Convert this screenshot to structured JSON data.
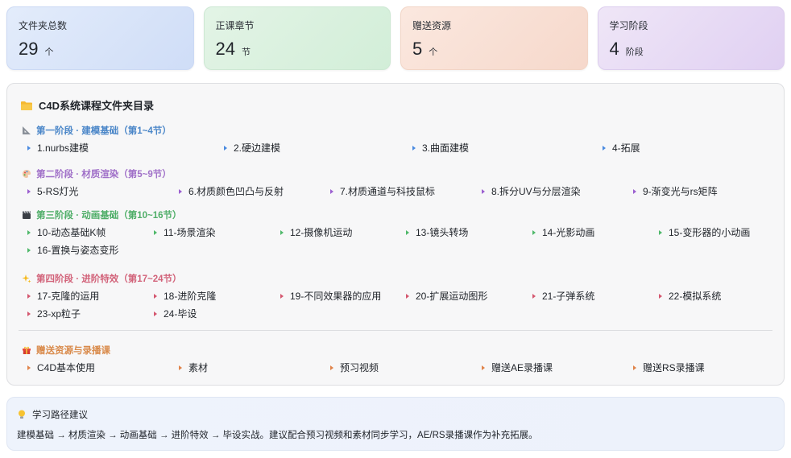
{
  "stats": [
    {
      "label": "文件夹总数",
      "value": "29",
      "unit": "个"
    },
    {
      "label": "正课章节",
      "value": "24",
      "unit": "节"
    },
    {
      "label": "赠送资源",
      "value": "5",
      "unit": "个"
    },
    {
      "label": "学习阶段",
      "value": "4",
      "unit": "阶段"
    }
  ],
  "catalog": {
    "title": "C4D系统课程文件夹目录",
    "icon": "folder-icon",
    "stages": [
      {
        "title": "第一阶段 · 建模基础（第1~4节）",
        "icon": "ruler-triangle-icon",
        "color": "#4a86c8",
        "marker_color": "#4a8ae0",
        "items": [
          "1.nurbs建模",
          "2.硬边建模",
          "3.曲面建模",
          "4-拓展"
        ]
      },
      {
        "title": "第二阶段 · 材质渲染（第5~9节）",
        "icon": "palette-icon",
        "color": "#a070c8",
        "marker_color": "#9b5fd0",
        "items": [
          "5-RS灯光",
          "6.材质颜色凹凸与反射",
          "7.材质通道与科技鼠标",
          "8.拆分UV与分层渲染",
          "9-渐变光与rs矩阵"
        ]
      },
      {
        "title": "第三阶段 · 动画基础（第10~16节）",
        "icon": "clapperboard-icon",
        "color": "#4fae68",
        "marker_color": "#4fb86a",
        "items": [
          "10-动态基础K帧",
          "11-场景渲染",
          "12-摄像机运动",
          "13-镜头转场",
          "14-光影动画",
          "15-变形器的小动画",
          "16-置换与姿态变形"
        ]
      },
      {
        "title": "第四阶段 · 进阶特效（第17~24节）",
        "icon": "sparkles-icon",
        "color": "#d2637a",
        "marker_color": "#d4576f",
        "items": [
          "17-克隆的运用",
          "18-进阶克隆",
          "19-不同效果器的应用",
          "20-扩展运动图形",
          "21-子弹系统",
          "22-模拟系统",
          "23-xp粒子",
          "24-毕设"
        ]
      }
    ],
    "bonus": {
      "title": "赠送资源与录播课",
      "icon": "gift-icon",
      "color": "#d98a4a",
      "marker_color": "#e0834a",
      "items": [
        "C4D基本使用",
        "素材",
        "预习视频",
        "赠送AE录播课",
        "赠送RS录播课"
      ]
    }
  },
  "tip": {
    "icon": "lightbulb-icon",
    "title": "学习路径建议",
    "text": "建模基础 → 材质渲染 → 动画基础 → 进阶特效 → 毕设实战。建议配合预习视频和素材同步学习，AE/RS录播课作为补充拓展。"
  }
}
